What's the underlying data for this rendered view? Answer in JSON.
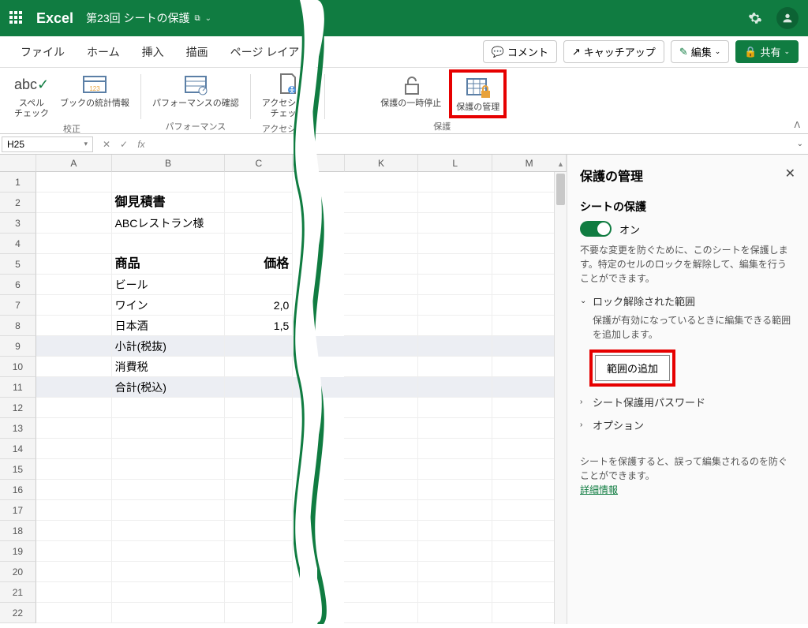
{
  "title": {
    "app": "Excel",
    "doc": "第23回 シートの保護"
  },
  "tabs": [
    "ファイル",
    "ホーム",
    "挿入",
    "描画",
    "ページ レイア"
  ],
  "pills": {
    "comment": "コメント",
    "catchup": "キャッチアップ",
    "edit": "編集",
    "share": "共有"
  },
  "ribbon": {
    "spell": "スペル\nチェック",
    "stats": "ブックの統計情報",
    "gProof": "校正",
    "perf": "パフォーマンスの確認",
    "gPerf": "パフォーマンス",
    "acc": "アクセシビリ\nチェック",
    "gAcc": "アクセシビリ",
    "pause": "保護の一時停止",
    "manage": "保護の管理",
    "gProt": "保護"
  },
  "namebox": "H25",
  "cols": [
    "A",
    "B",
    "C",
    "K",
    "L",
    "M"
  ],
  "cells": {
    "B2": "御見積書",
    "B3": "ABCレストラン様",
    "B5": "商品",
    "C5": "価格",
    "B6": "ビール",
    "B7": "ワイン",
    "C7": "2,0",
    "B8": "日本酒",
    "C8": "1,5",
    "B9": "小計(税抜)",
    "B10": "消費税",
    "B11": "合計(税込)"
  },
  "rows": 22,
  "panel": {
    "title": "保護の管理",
    "sheet_protect": "シートの保護",
    "on": "オン",
    "desc1": "不要な変更を防ぐために、このシートを保護します。特定のセルのロックを解除して、編集を行うことができます。",
    "unlocked": "ロック解除された範囲",
    "unlocked_desc": "保護が有効になっているときに編集できる範囲を追加します。",
    "add": "範囲の追加",
    "pw": "シート保護用パスワード",
    "options": "オプション",
    "foot": "シートを保護すると、誤って編集されるのを防ぐことができます。",
    "link": "詳細情報"
  }
}
